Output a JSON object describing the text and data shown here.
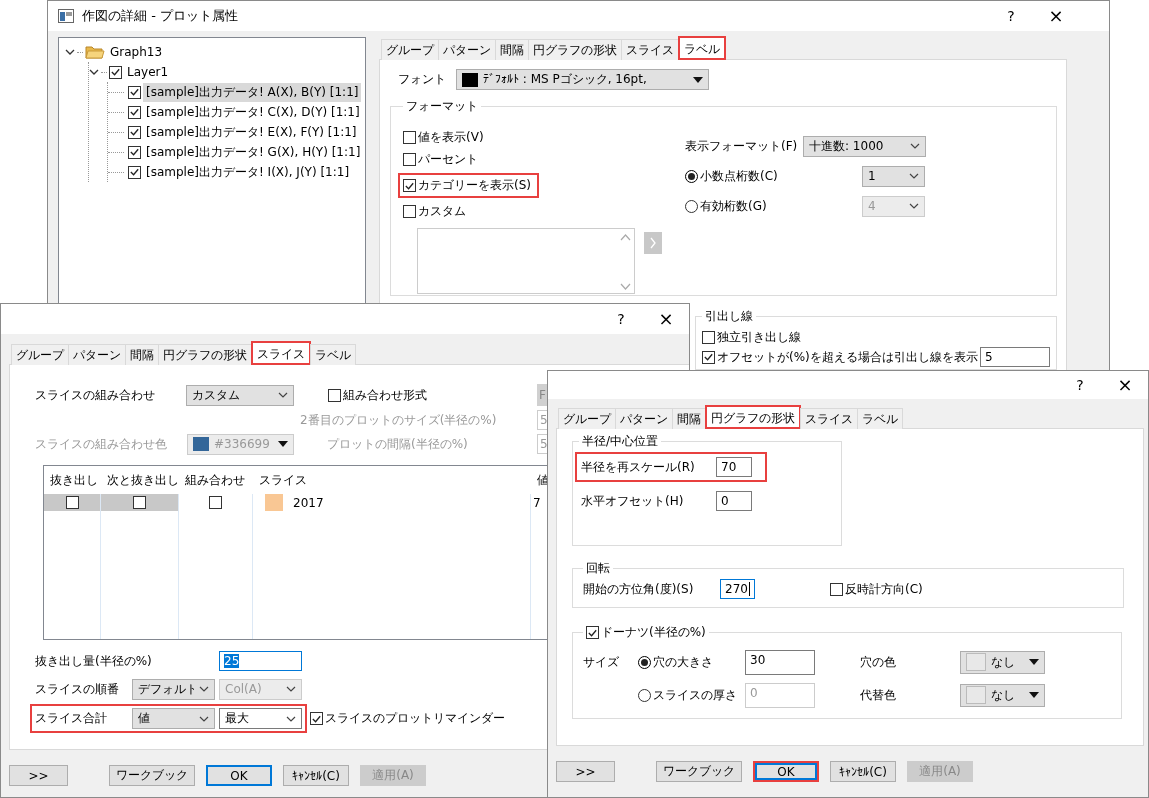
{
  "plot_details_window": {
    "title": "作図の詳細 - プロット属性",
    "help": "?",
    "close": "×",
    "tree": [
      {
        "label": "Graph13",
        "expanded": true,
        "children": [
          {
            "label": "Layer1",
            "checked": true,
            "expanded": true,
            "children": [
              {
                "label": "[sample]出力データ! A(X), B(Y) [1:1]",
                "checked": true,
                "selected": true
              },
              {
                "label": "[sample]出力データ! C(X), D(Y) [1:1]",
                "checked": true,
                "selected": false
              },
              {
                "label": "[sample]出力データ! E(X), F(Y) [1:1]",
                "checked": true,
                "selected": false
              },
              {
                "label": "[sample]出力データ! G(X), H(Y) [1:1]",
                "checked": true,
                "selected": false
              },
              {
                "label": "[sample]出力データ! I(X), J(Y) [1:1]",
                "checked": true,
                "selected": false
              }
            ]
          }
        ]
      }
    ],
    "tabs": [
      {
        "label": "グループ",
        "selected": false,
        "highlighted": false
      },
      {
        "label": "パターン",
        "selected": false,
        "highlighted": false
      },
      {
        "label": "間隔",
        "selected": false,
        "highlighted": false
      },
      {
        "label": "円グラフの形状",
        "selected": false,
        "highlighted": false
      },
      {
        "label": "スライス",
        "selected": false,
        "highlighted": false
      },
      {
        "label": "ラベル",
        "selected": true,
        "highlighted": true
      }
    ],
    "font": {
      "label": "フォント",
      "value": "ﾃﾞﾌｫﾙﾄ : MS Pゴシック, 16pt,",
      "color": "#000000"
    },
    "format": {
      "title": "フォーマット",
      "options": [
        {
          "label": "値を表示(V)",
          "checked": false,
          "highlighted": false
        },
        {
          "label": "パーセント",
          "checked": false,
          "highlighted": false
        },
        {
          "label": "カテゴリーを表示(S)",
          "checked": true,
          "highlighted": true
        },
        {
          "label": "カスタム",
          "checked": false,
          "highlighted": false
        }
      ],
      "display_format": {
        "label": "表示フォーマット(F)",
        "value": "十進数: 1000"
      },
      "digits": [
        {
          "label": "小数点桁数(C)",
          "selected": true,
          "value": "1"
        },
        {
          "label": "有効桁数(G)",
          "selected": false,
          "value": "4"
        }
      ]
    },
    "leader_lines": {
      "title": "引出し線",
      "options": [
        {
          "label": "独立引き出し線",
          "checked": false
        },
        {
          "label": "オフセットが(%)を超える場合は引出し線を表示",
          "checked": true,
          "value": "5"
        }
      ]
    }
  },
  "slice_tab_window": {
    "help": "?",
    "close": "×",
    "tabs": [
      {
        "label": "グループ",
        "selected": false,
        "highlighted": false
      },
      {
        "label": "パターン",
        "selected": false,
        "highlighted": false
      },
      {
        "label": "間隔",
        "selected": false,
        "highlighted": false
      },
      {
        "label": "円グラフの形状",
        "selected": false,
        "highlighted": false
      },
      {
        "label": "スライス",
        "selected": true,
        "highlighted": true
      },
      {
        "label": "ラベル",
        "selected": false,
        "highlighted": false
      }
    ],
    "combination": {
      "label": "スライスの組み合わせ",
      "value": "カスタム"
    },
    "combine_format": {
      "label": "組み合わせ形式",
      "checked": false
    },
    "format_button": "F",
    "second_plot_size": {
      "label": "2番目のプロットのサイズ(半径の%)",
      "value": "5"
    },
    "combination_color": {
      "label": "スライスの組み合わせ色",
      "value": "#336699",
      "color": "#336699"
    },
    "plot_gap": {
      "label": "プロットの間隔(半径の%)",
      "value": "5"
    },
    "table": {
      "columns": [
        "抜き出し",
        "次と抜き出し",
        "組み合わせ",
        "スライス",
        "値"
      ],
      "rows": [
        {
          "explode": false,
          "explode_next": false,
          "combine": false,
          "color": "#f9c794",
          "slice": "2017",
          "value": "7",
          "selected": true
        }
      ]
    },
    "explode_amount": {
      "label": "抜き出し量(半径の%)",
      "value": "25",
      "selected": true
    },
    "order": {
      "label": "スライスの順番",
      "value": "デフォルト",
      "column": {
        "value": "Col(A)",
        "disabled": true
      }
    },
    "total": {
      "label": "スライス合計",
      "value": "値",
      "mode": "最大",
      "highlighted": true
    },
    "reminder": {
      "label": "スライスのプロットリマインダー",
      "checked": true
    },
    "buttons": [
      {
        "kind": "more",
        "label": ">>",
        "default": false,
        "disabled": false,
        "highlighted": false
      },
      {
        "kind": "workbook",
        "label": "ワークブック",
        "default": false,
        "disabled": false,
        "highlighted": false
      },
      {
        "kind": "ok",
        "label": "OK",
        "default": true,
        "disabled": false,
        "highlighted": false
      },
      {
        "kind": "cancel",
        "label": "ｷｬﾝｾﾙ(C)",
        "default": false,
        "disabled": false,
        "highlighted": false
      },
      {
        "kind": "apply",
        "label": "適用(A)",
        "default": false,
        "disabled": true,
        "highlighted": false
      }
    ]
  },
  "pie_shape_window": {
    "help": "?",
    "close": "×",
    "tabs": [
      {
        "label": "グループ",
        "selected": false,
        "highlighted": false
      },
      {
        "label": "パターン",
        "selected": false,
        "highlighted": false
      },
      {
        "label": "間隔",
        "selected": false,
        "highlighted": false
      },
      {
        "label": "円グラフの形状",
        "selected": true,
        "highlighted": true
      },
      {
        "label": "スライス",
        "selected": false,
        "highlighted": false
      },
      {
        "label": "ラベル",
        "selected": false,
        "highlighted": false
      }
    ],
    "radius_center": {
      "title": "半径/中心位置",
      "fields": [
        {
          "label": "半径を再スケール(R)",
          "value": "70",
          "highlighted": true
        },
        {
          "label": "水平オフセット(H)",
          "value": "0",
          "highlighted": false
        }
      ]
    },
    "rotation": {
      "title": "回転",
      "start_angle": {
        "label": "開始の方位角(度)(S)",
        "value": "270",
        "focused": true
      },
      "counterclockwise": {
        "label": "反時計方向(C)",
        "checked": false
      }
    },
    "donut": {
      "title": "ドーナツ(半径の%)",
      "checked": true,
      "size_label": "サイズ",
      "options": [
        {
          "label": "穴の大きさ",
          "selected": true,
          "value": "30"
        },
        {
          "label": "スライスの厚さ",
          "selected": false,
          "value": "0"
        }
      ],
      "colors": [
        {
          "label": "穴の色",
          "value": "なし"
        },
        {
          "label": "代替色",
          "value": "なし"
        }
      ]
    },
    "buttons": [
      {
        "kind": "more",
        "label": ">>",
        "default": false,
        "disabled": false,
        "highlighted": false
      },
      {
        "kind": "workbook",
        "label": "ワークブック",
        "default": false,
        "disabled": false,
        "highlighted": false
      },
      {
        "kind": "ok",
        "label": "OK",
        "default": true,
        "disabled": false,
        "highlighted": true
      },
      {
        "kind": "cancel",
        "label": "ｷｬﾝｾﾙ(C)",
        "default": false,
        "disabled": false,
        "highlighted": false
      },
      {
        "kind": "apply",
        "label": "適用(A)",
        "default": false,
        "disabled": true,
        "highlighted": false
      }
    ]
  }
}
